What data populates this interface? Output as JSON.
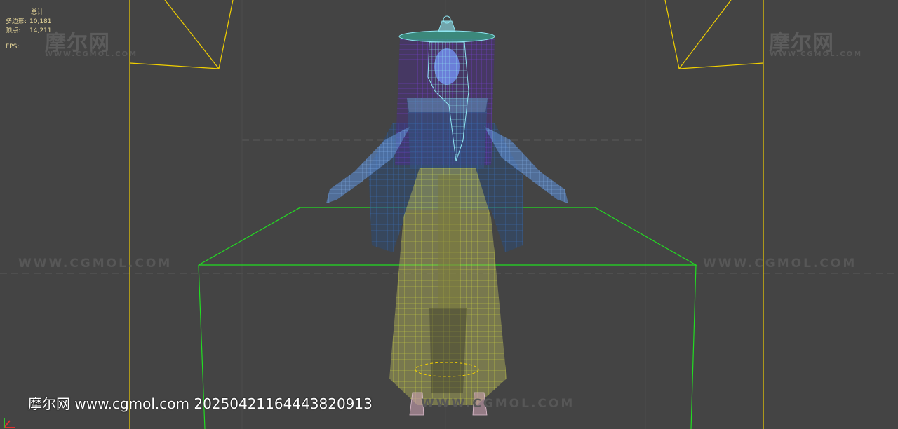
{
  "viewport": {
    "stats_header": "总计",
    "polygons_label": "多边形:",
    "polygons_value": "10,181",
    "vertices_label": "顶点:",
    "vertices_value": "14,211",
    "fps_label": "FPS:"
  },
  "watermarks": {
    "logo_text": "摩尔网",
    "logo_sub": "WWW.CGMOL.COM",
    "url_text": "WWW.CGMOL.COM"
  },
  "footer": {
    "text": "摩尔网 www.cgmol.com 20250421164443820913"
  },
  "colors": {
    "background": "#444444",
    "camera_lines": "#f2d000",
    "platform_lines": "#22dd22",
    "hat_wire": "#7a3fd6",
    "hair_wire": "#8fe6f2",
    "skirt_wire": "#c8d040",
    "cape_wire": "#3a6fb8",
    "stats_text": "#e8d89a"
  },
  "icons": [
    "axis-gizmo-icon"
  ]
}
